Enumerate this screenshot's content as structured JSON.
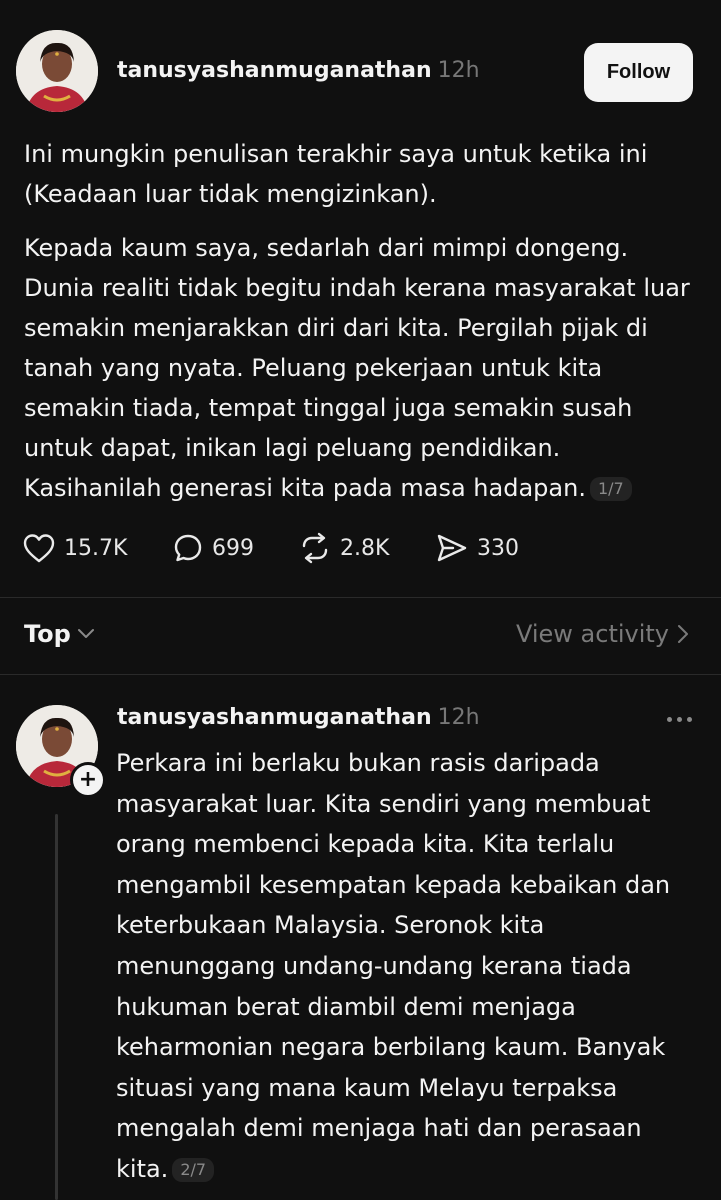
{
  "post": {
    "username": "tanusyashanmuganathan",
    "time": "12h",
    "follow_label": "Follow",
    "paragraph1": "Ini mungkin penulisan terakhir saya untuk ketika ini (Keadaan luar tidak mengizinkan).",
    "paragraph2": "Kepada kaum saya, sedarlah dari mimpi dongeng. Dunia realiti tidak begitu indah kerana masyarakat luar semakin menjarakkan diri dari kita. Pergilah pijak di tanah yang nyata.  Peluang pekerjaan untuk kita semakin tiada, tempat tinggal juga semakin susah untuk dapat, inikan lagi peluang pendidikan. Kasihanilah generasi kita pada masa hadapan.",
    "pager": "1/7",
    "actions": {
      "likes": "15.7K",
      "replies": "699",
      "reposts": "2.8K",
      "shares": "330"
    },
    "icons": [
      "heart-icon",
      "comment-icon",
      "repost-icon",
      "share-icon"
    ]
  },
  "sort_bar": {
    "sort_label": "Top",
    "view_activity_label": "View activity"
  },
  "reply": {
    "username": "tanusyashanmuganathan",
    "time": "12h",
    "text": "Perkara ini berlaku bukan rasis daripada masyarakat luar. Kita sendiri yang membuat orang membenci kepada kita. Kita terlalu mengambil kesempatan kepada kebaikan dan keterbukaan Malaysia. Seronok kita menunggang undang-undang kerana tiada hukuman berat diambil demi menjaga keharmonian negara berbilang kaum. Banyak situasi yang mana kaum Melayu terpaksa mengalah demi menjaga hati dan perasaan kita.",
    "pager": "2/7",
    "plus_symbol": "+"
  },
  "colors": {
    "background": "#101010",
    "text": "#f3f3f3",
    "muted": "#777777",
    "button_bg": "#f4f4f4"
  }
}
